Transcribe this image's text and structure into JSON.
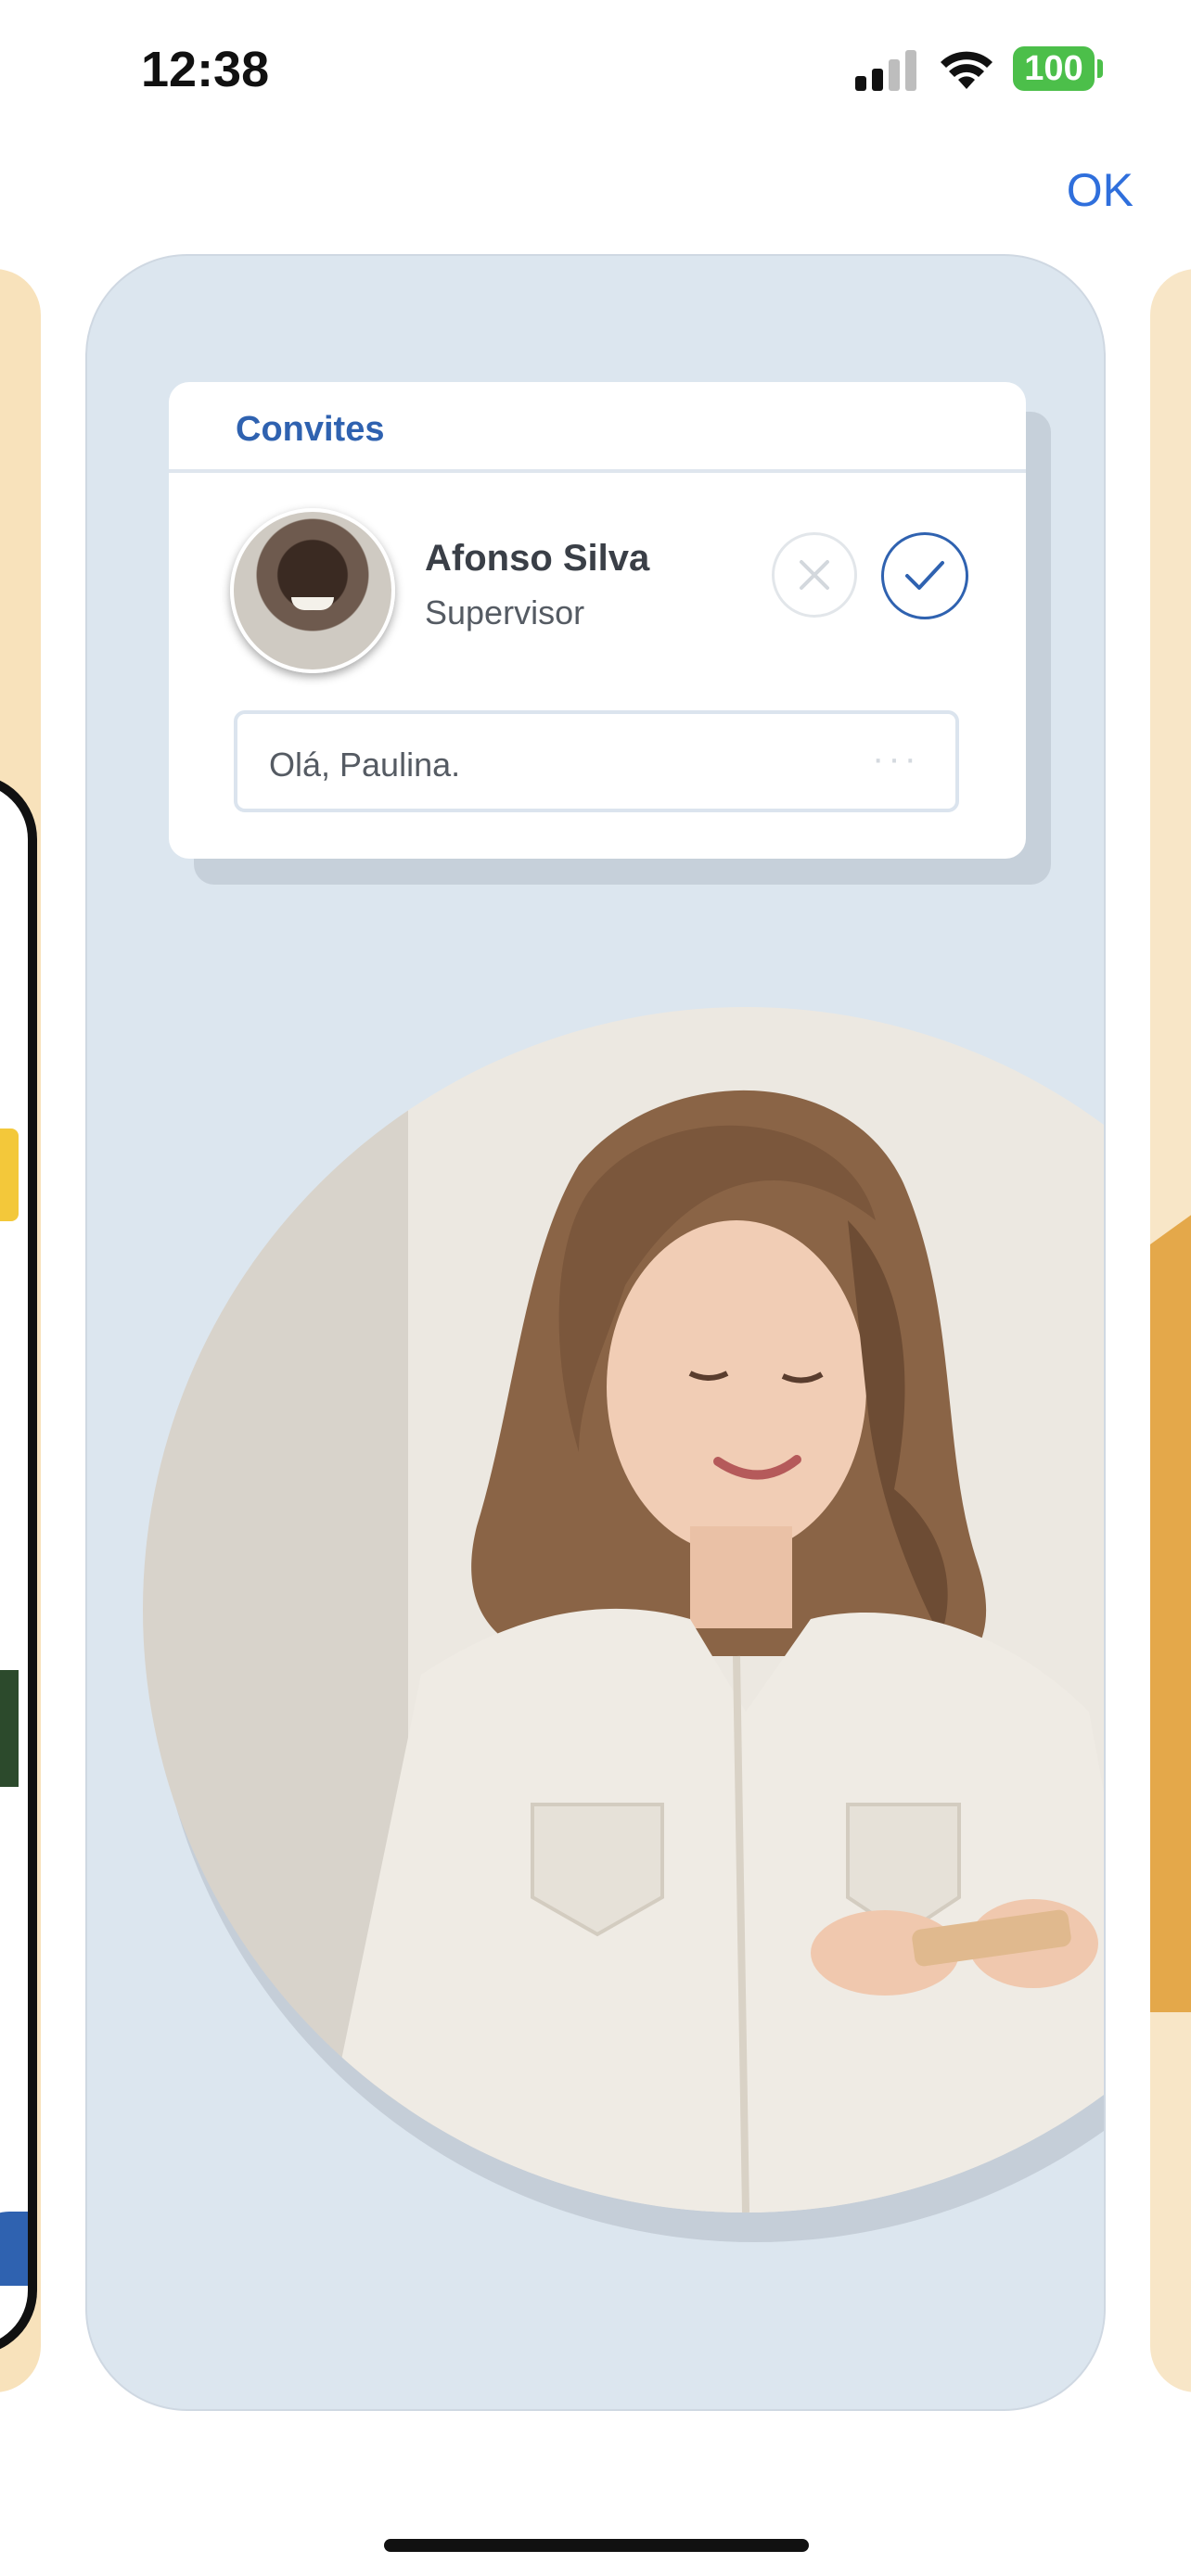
{
  "status_bar": {
    "time": "12:38",
    "battery": "100",
    "icons": [
      "cellular-signal-icon",
      "wifi-icon",
      "battery-icon"
    ]
  },
  "header": {
    "done_label": "OK"
  },
  "invite_card": {
    "title": "Convites",
    "person": {
      "name": "Afonso Silva",
      "role": "Supervisor"
    },
    "message": "Olá, Paulina.",
    "more_dots": "···",
    "decline_icon": "close-icon",
    "accept_icon": "check-icon"
  },
  "colors": {
    "accent": "#2f62b0",
    "link": "#2f6fdc",
    "card_background": "#dce6ef",
    "peek_background": "#f8e2bb",
    "battery": "#4cbf4a"
  }
}
